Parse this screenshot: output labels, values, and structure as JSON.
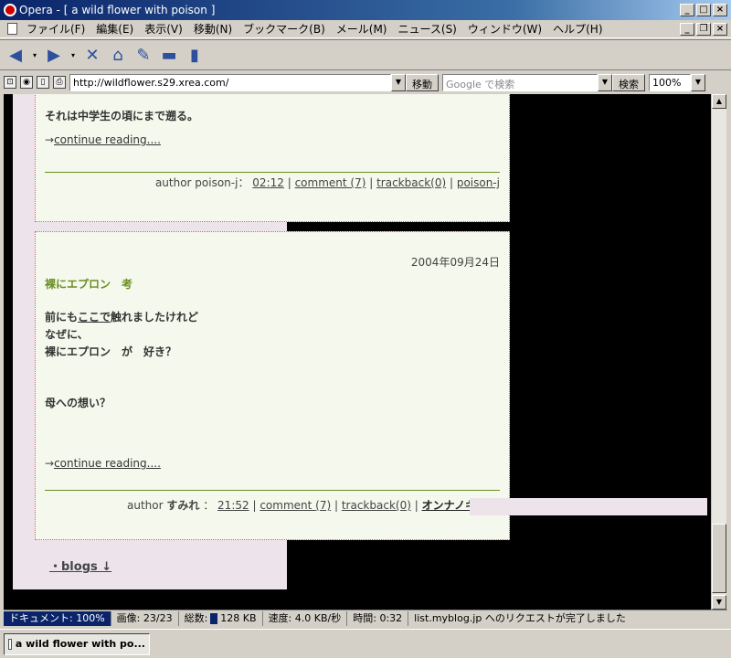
{
  "window": {
    "title": "Opera - [ a wild flower with poison ]"
  },
  "menu": [
    "ファイル(F)",
    "編集(E)",
    "表示(V)",
    "移動(N)",
    "ブックマーク(B)",
    "メール(M)",
    "ニュース(S)",
    "ウィンドウ(W)",
    "ヘルプ(H)"
  ],
  "address": {
    "url": "http://wildflower.s29.xrea.com/",
    "go_label": "移動",
    "search_placeholder": "Google で検索",
    "search_label": "検索",
    "zoom": "100%"
  },
  "post1": {
    "text": "それは中学生の頃にまで遡る。",
    "continue_arrow": "→",
    "continue": "continue reading....",
    "author_label": "author poison-j：",
    "time": "02:12",
    "comment": "comment (7)",
    "trackback": "trackback(0)",
    "category": "poison-j"
  },
  "post2": {
    "date": "2004年09月24日",
    "title": "裸にエプロン　考",
    "line1_prefix": "前にも",
    "line1_link": "ここで",
    "line1_suffix": "触れましたけれど",
    "line2": "なぜに、",
    "line3": "裸にエプロン　が　好き？",
    "line4": "母への想い？",
    "continue_arrow": "→",
    "continue": "continue reading....",
    "author_label": "author",
    "author_name": "すみれ",
    "time": "21:52",
    "comment": "comment (7)",
    "trackback": "trackback(0)",
    "category": "オンナノキモチ"
  },
  "sidebar": {
    "blogs": "・blogs ↓"
  },
  "status": {
    "document": "ドキュメント: 100%",
    "images_label": "画像:",
    "images": "23/23",
    "total_label": "総数:",
    "total": "128 KB",
    "speed_label": "速度:",
    "speed": "4.0 KB/秒",
    "time_label": "時間:",
    "time": "0:32",
    "message": "list.myblog.jp へのリクエストが完了しました"
  },
  "taskbar": {
    "item": "a wild flower with po..."
  },
  "colors": {
    "title_green": "#6b8e23",
    "post_bg": "#f5f8ec",
    "post_border": "#e05a6a",
    "panel_pink": "#ece4ea"
  }
}
